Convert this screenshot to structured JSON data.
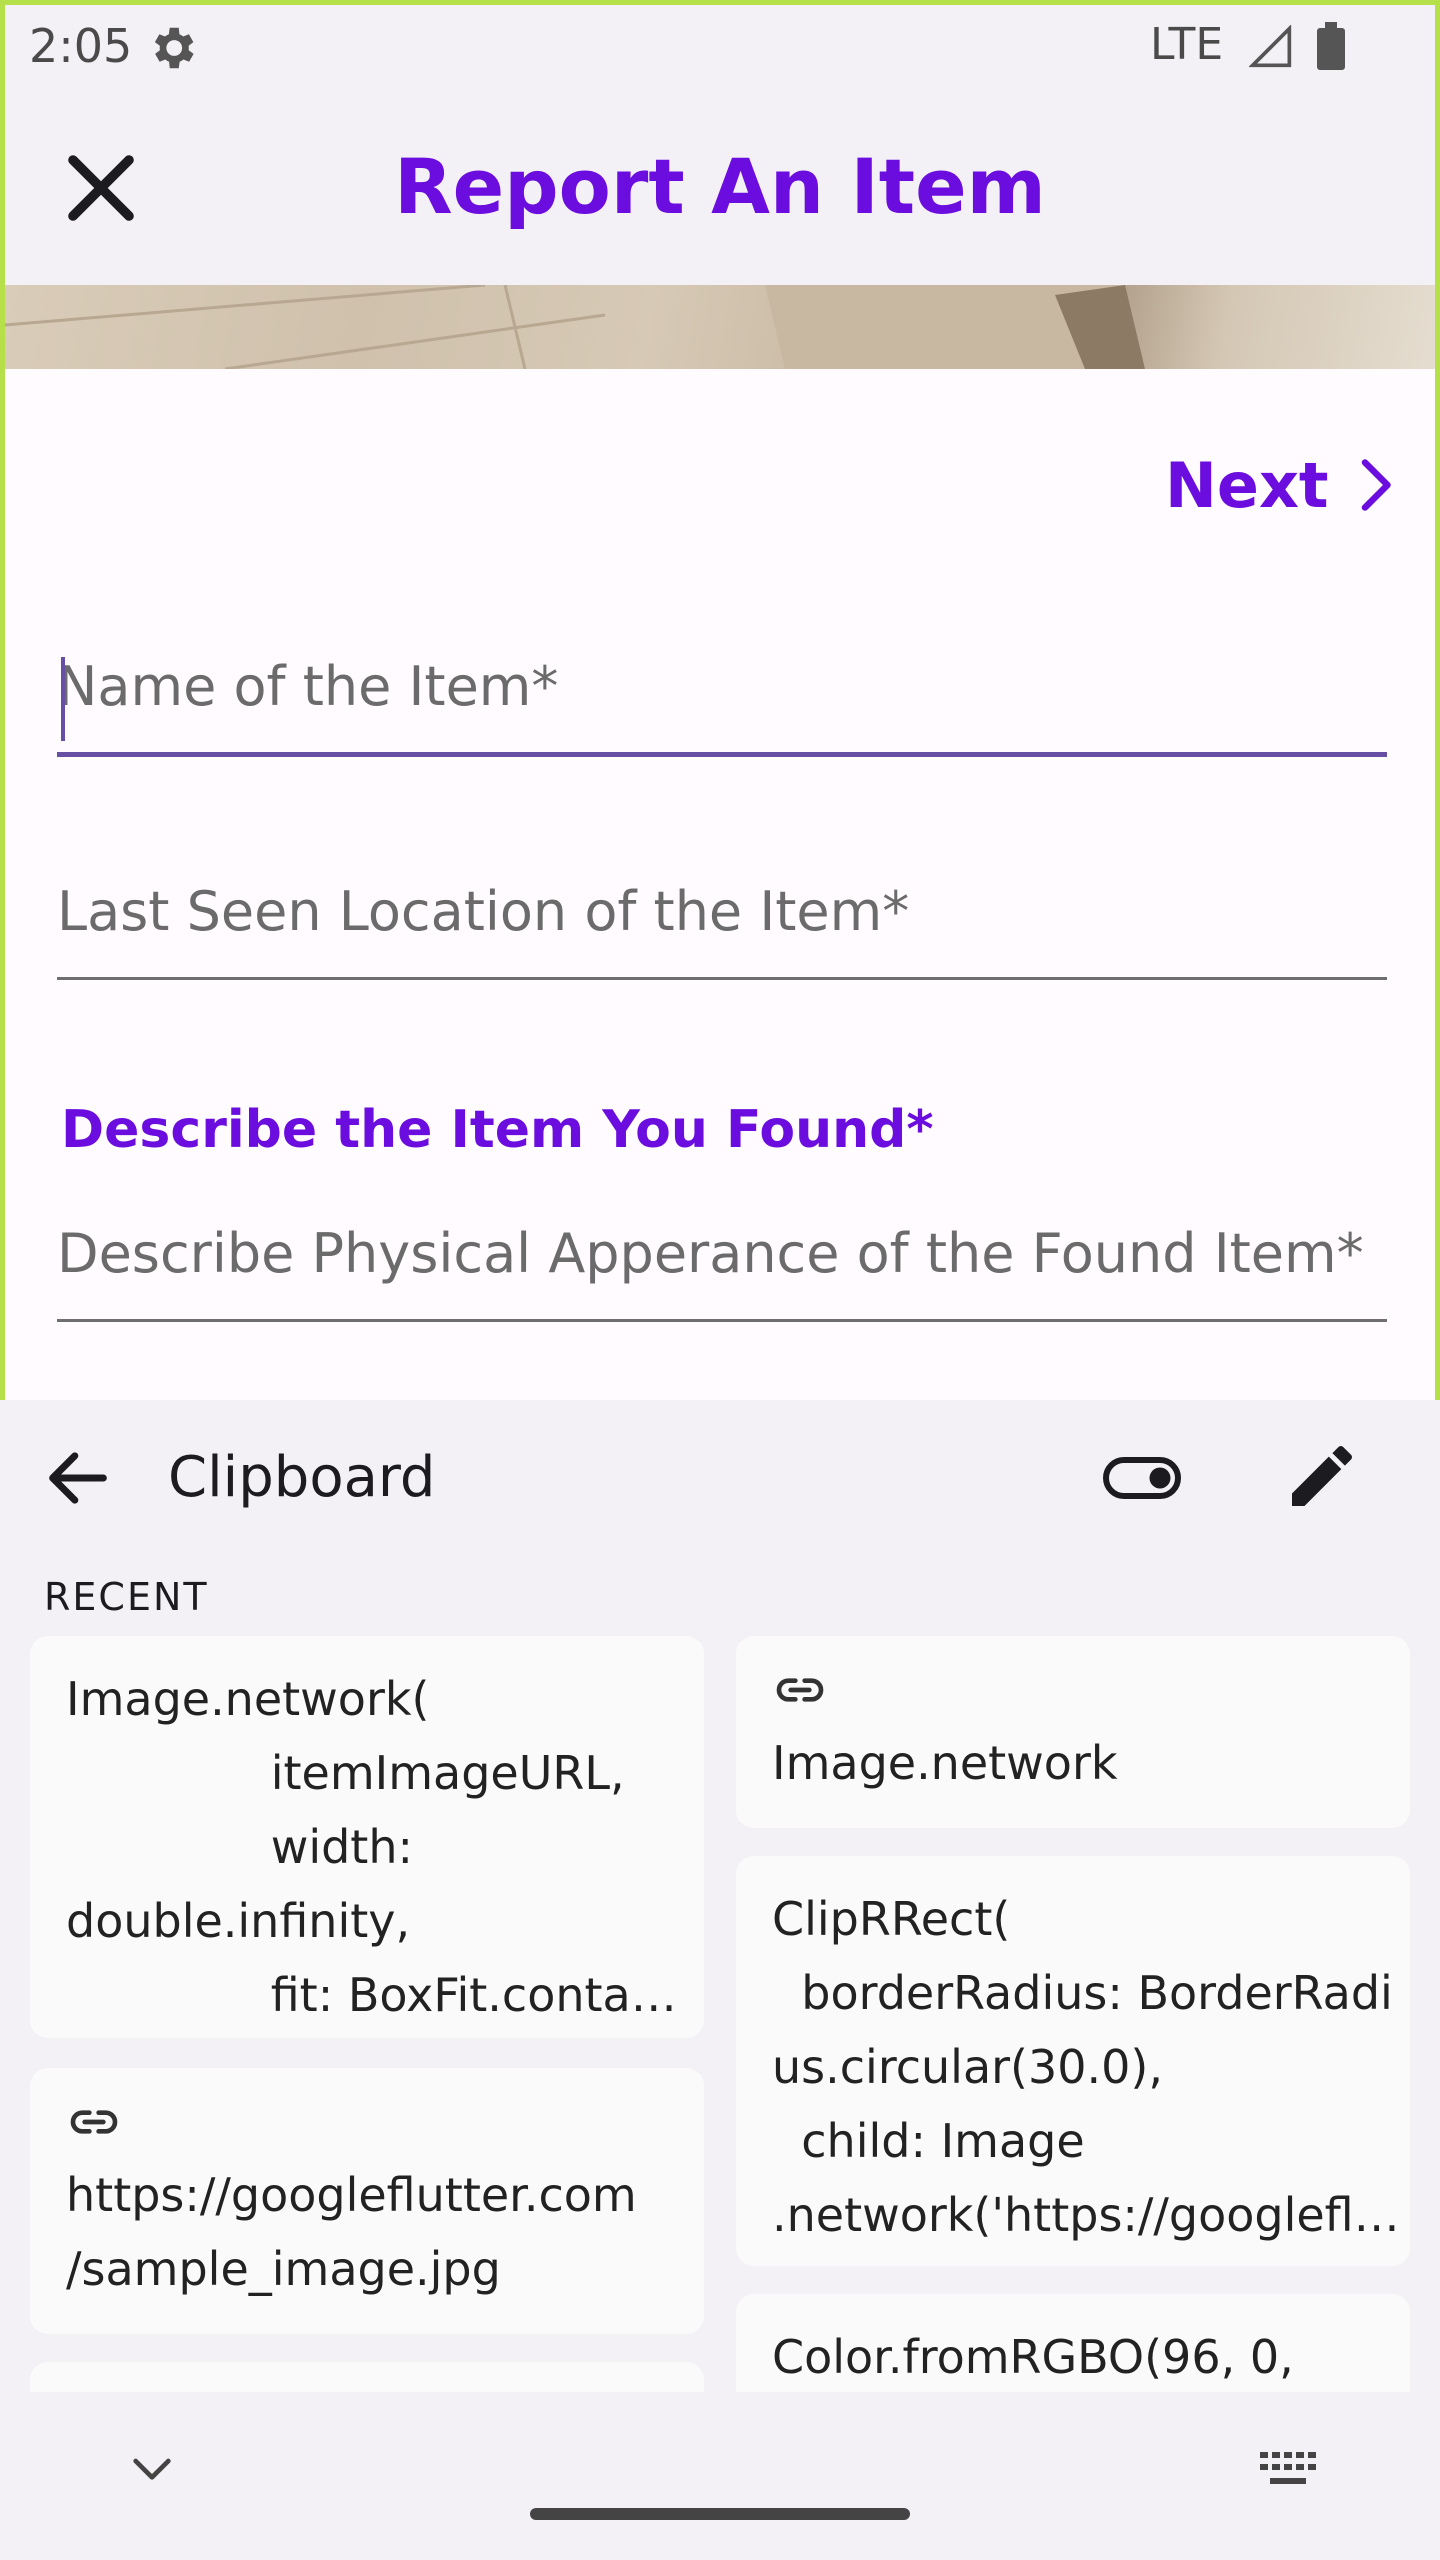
{
  "status_bar": {
    "time": "2:05",
    "network": "LTE"
  },
  "app_bar": {
    "title": "Report An Item"
  },
  "form": {
    "next_label": "Next",
    "name_placeholder": "Name of the Item*",
    "location_placeholder": "Last Seen Location of the Item*",
    "section_label": "Describe the Item You Found*",
    "description_placeholder": "Describe Physical Apperance of the Found Item*"
  },
  "clipboard": {
    "title": "Clipboard",
    "recent_label": "RECENT",
    "items": [
      {
        "text": "Image.network(\n              itemImageURL,\n              width:\ndouble.infinity,\n              fit: BoxFit.conta…"
      },
      {
        "text": "Image.network",
        "is_link": true
      },
      {
        "text": "https://googleflutter.com\n/sample_image.jpg",
        "is_link": true
      },
      {
        "text": "ClipRRect(\n  borderRadius: BorderRadi\nus.circular(30.0),\n  child: Image\n.network('https://googlefl…"
      },
      {
        "text": "Color.fromRGBO(96, 0,"
      }
    ]
  },
  "colors": {
    "accent": "#6a0dde",
    "field_focus": "#6750a4",
    "frame": "#b5e04a"
  }
}
